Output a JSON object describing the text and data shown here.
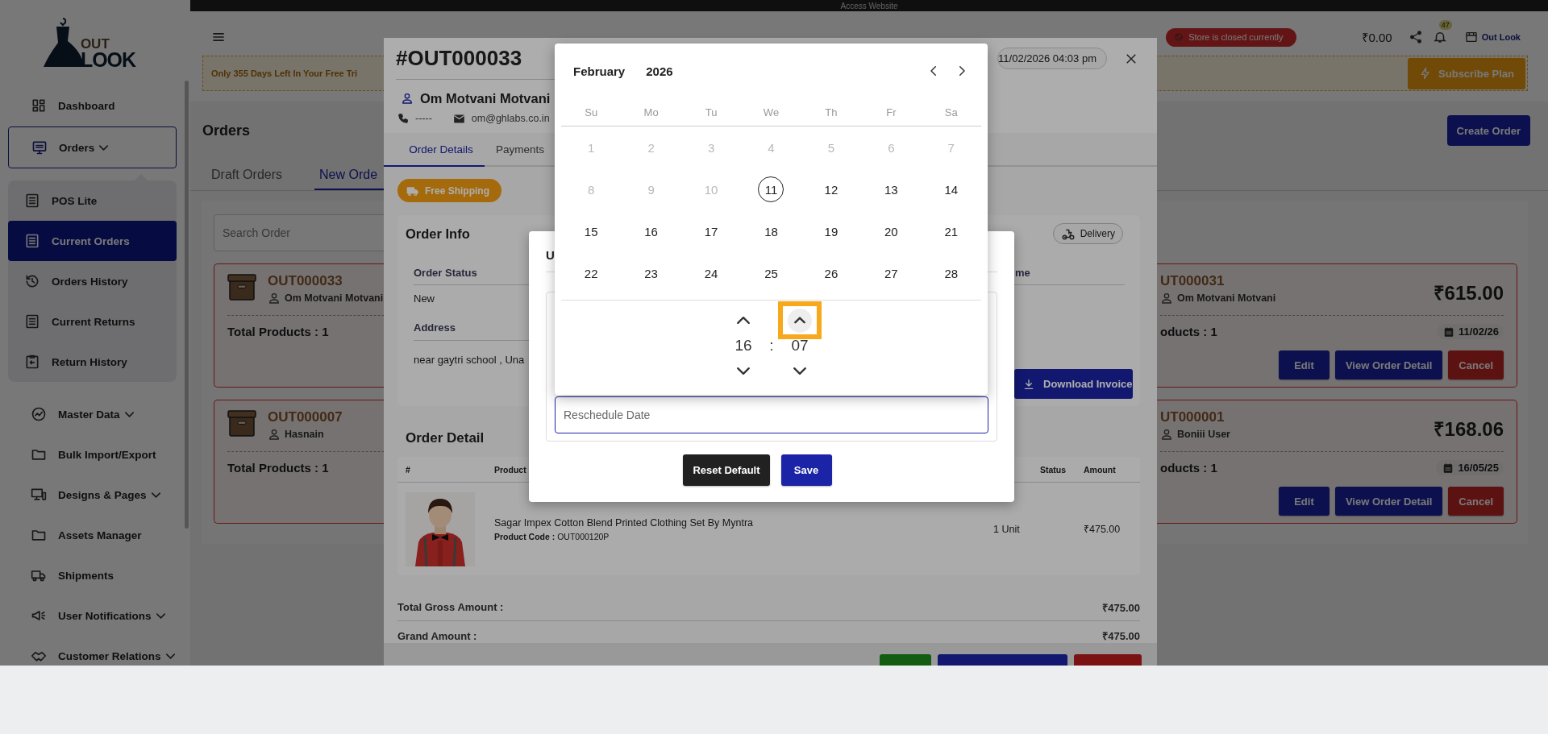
{
  "top_bar": {
    "title": "Access Website"
  },
  "sidebar": {
    "logo": {
      "line1": "OUT",
      "line2": "LOOK"
    },
    "items": [
      {
        "label": "Dashboard",
        "expandable": false,
        "expanded": false,
        "selected": false
      },
      {
        "label": "Orders",
        "expandable": true,
        "expanded": true,
        "selected": false,
        "children": [
          {
            "label": "POS Lite",
            "selected": false
          },
          {
            "label": "Current Orders",
            "selected": true
          },
          {
            "label": "Orders History",
            "selected": false
          },
          {
            "label": "Current Returns",
            "selected": false
          },
          {
            "label": "Return History",
            "selected": false
          }
        ]
      },
      {
        "label": "Master Data",
        "expandable": true,
        "expanded": false,
        "selected": false
      },
      {
        "label": "Bulk Import/Export",
        "expandable": false,
        "expanded": false,
        "selected": false
      },
      {
        "label": "Designs & Pages",
        "expandable": true,
        "expanded": false,
        "selected": false
      },
      {
        "label": "Assets Manager",
        "expandable": false,
        "expanded": false,
        "selected": false
      },
      {
        "label": "Shipments",
        "expandable": false,
        "expanded": false,
        "selected": false
      },
      {
        "label": "User Notifications",
        "expandable": true,
        "expanded": false,
        "selected": false
      },
      {
        "label": "Customer Relations",
        "expandable": true,
        "expanded": false,
        "selected": false
      }
    ]
  },
  "header": {
    "store_status": "Store is closed currently",
    "balance": "₹0.00",
    "notifications": "47",
    "store_name": "Out Look",
    "trial_banner": "Only 355 Days Left In Your Free Tri",
    "subscribe_button": "Subscribe Plan"
  },
  "orders_page": {
    "title": "Orders",
    "create_button": "Create Order",
    "tabs": [
      {
        "label": "Draft Orders",
        "selected": false
      },
      {
        "label": "New Orde",
        "selected": true
      }
    ],
    "search": {
      "placeholder": "Search Order"
    },
    "cards_left": [
      {
        "order_id": "OUT000033",
        "customer": "Om Motvani Motvani",
        "total": "Total Products : 1"
      },
      {
        "order_id": "OUT000007",
        "customer": "Hasnain",
        "total": "Total Products : 1"
      }
    ],
    "cards_right": [
      {
        "order_id": "UT000031",
        "customer": "Om Motvani Motvani",
        "total": "oducts : 1",
        "amount": "₹615.00",
        "date": "11/02/26",
        "buttons": [
          {
            "label": "Edit",
            "kind": "primary"
          },
          {
            "label": "View Order Detail",
            "kind": "primary"
          },
          {
            "label": "Cancel",
            "kind": "danger"
          }
        ]
      },
      {
        "order_id": "UT000001",
        "customer": "Boniii User",
        "total": "oducts : 1",
        "amount": "₹168.06",
        "date": "16/05/25",
        "buttons": [
          {
            "label": "Edit",
            "kind": "primary"
          },
          {
            "label": "View Order Detail",
            "kind": "primary"
          },
          {
            "label": "Cancel",
            "kind": "danger"
          }
        ]
      }
    ]
  },
  "order_drawer": {
    "order_number": "#OUT000033",
    "date": "11/02/2026 04:03 pm",
    "customer": "Om Motvani Motvani",
    "phone": "-----",
    "email": "om@ghlabs.co.in",
    "tabs": [
      {
        "label": "Order Details",
        "selected": true
      },
      {
        "label": "Payments",
        "selected": false
      }
    ],
    "shipping_badge": "Free Shipping",
    "order_info": {
      "title": "Order Info",
      "delivery_badge": "Delivery",
      "fields": [
        {
          "label": "Order Status",
          "value": "New"
        },
        {
          "label": "Address",
          "value": "near gaytri school , Una"
        }
      ],
      "column_2_label": "me",
      "invoice_button": "Download Invoice"
    },
    "order_detail": {
      "title": "Order Detail",
      "columns": [
        "#",
        "Product",
        "Status",
        "Amount"
      ],
      "rows": [
        {
          "product": "Sagar Impex Cotton Blend Printed Clothing Set By Myntra",
          "code": "**Product Code :** OUT000120P",
          "quantity": "1 Unit",
          "amount": "₹475.00"
        }
      ]
    },
    "totals": [
      {
        "label": "Total Gross Amount :",
        "value": "₹475.00"
      },
      {
        "label": "Grand Amount :",
        "value": "₹475.00"
      }
    ],
    "footer_buttons": [
      {
        "kind": "success"
      },
      {
        "kind": "primary"
      },
      {
        "kind": "danger"
      }
    ]
  },
  "dialog": {
    "title": "U",
    "field": {
      "placeholder": "Reschedule Date"
    },
    "buttons": [
      {
        "label": "Reset Default",
        "kind": "dark"
      },
      {
        "label": "Save",
        "kind": "primary"
      }
    ]
  },
  "calendar": {
    "month": "February",
    "year": "2026",
    "weekdays": [
      "Su",
      "Mo",
      "Tu",
      "We",
      "Th",
      "Fr",
      "Sa"
    ],
    "days": [
      {
        "label": "1",
        "disabled": true,
        "today": false
      },
      {
        "label": "2",
        "disabled": true,
        "today": false
      },
      {
        "label": "3",
        "disabled": true,
        "today": false
      },
      {
        "label": "4",
        "disabled": true,
        "today": false
      },
      {
        "label": "5",
        "disabled": true,
        "today": false
      },
      {
        "label": "6",
        "disabled": true,
        "today": false
      },
      {
        "label": "7",
        "disabled": true,
        "today": false
      },
      {
        "label": "8",
        "disabled": true,
        "today": false
      },
      {
        "label": "9",
        "disabled": true,
        "today": false
      },
      {
        "label": "10",
        "disabled": true,
        "today": false
      },
      {
        "label": "11",
        "disabled": false,
        "today": true
      },
      {
        "label": "12",
        "disabled": false,
        "today": false
      },
      {
        "label": "13",
        "disabled": false,
        "today": false
      },
      {
        "label": "14",
        "disabled": false,
        "today": false
      },
      {
        "label": "15",
        "disabled": false,
        "today": false
      },
      {
        "label": "16",
        "disabled": false,
        "today": false
      },
      {
        "label": "17",
        "disabled": false,
        "today": false
      },
      {
        "label": "18",
        "disabled": false,
        "today": false
      },
      {
        "label": "19",
        "disabled": false,
        "today": false
      },
      {
        "label": "20",
        "disabled": false,
        "today": false
      },
      {
        "label": "21",
        "disabled": false,
        "today": false
      },
      {
        "label": "22",
        "disabled": false,
        "today": false
      },
      {
        "label": "23",
        "disabled": false,
        "today": false
      },
      {
        "label": "24",
        "disabled": false,
        "today": false
      },
      {
        "label": "25",
        "disabled": false,
        "today": false
      },
      {
        "label": "26",
        "disabled": false,
        "today": false
      },
      {
        "label": "27",
        "disabled": false,
        "today": false
      },
      {
        "label": "28",
        "disabled": false,
        "today": false
      }
    ],
    "time": {
      "hour": "16",
      "separator": ":",
      "minute": "07",
      "minute_up_focused": true
    }
  }
}
